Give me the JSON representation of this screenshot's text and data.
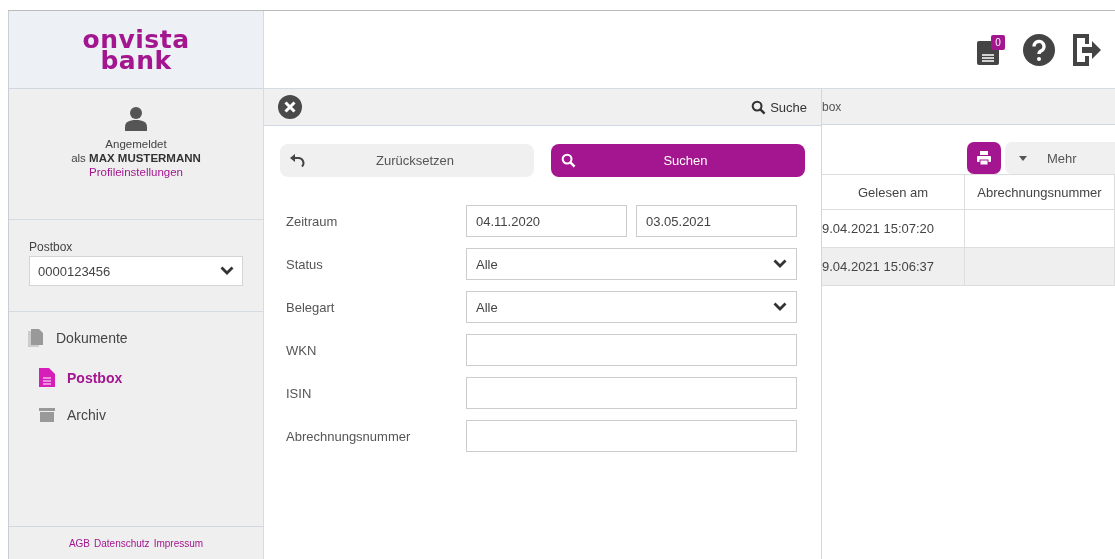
{
  "logo": {
    "line1": "onvista",
    "line2": "bank"
  },
  "user": {
    "status": "Angemeldet",
    "prefix": "als",
    "name": "MAX MUSTERMANN",
    "profile_link": "Profileinstellungen"
  },
  "postbox": {
    "label": "Postbox",
    "value": "0000123456"
  },
  "nav": [
    {
      "label": "Dokumente",
      "selected": false,
      "kind": "documents",
      "children": [
        {
          "label": "Postbox",
          "selected": true,
          "kind": "file"
        },
        {
          "label": "Archiv",
          "selected": false,
          "kind": "archive"
        }
      ]
    }
  ],
  "footer_links": [
    "AGB",
    "Datenschutz",
    "Impressum"
  ],
  "header": {
    "notification_count": "0"
  },
  "breadcrumb": "box",
  "search_panel": {
    "title": "Suche",
    "reset_button": "Zurücksetzen",
    "search_button": "Suchen",
    "fields": [
      {
        "label": "Zeitraum",
        "kind": "range",
        "values": [
          "04.11.2020",
          "03.05.2021"
        ]
      },
      {
        "label": "Status",
        "kind": "select",
        "value": "Alle"
      },
      {
        "label": "Belegart",
        "kind": "select",
        "value": "Alle"
      },
      {
        "label": "WKN",
        "kind": "text"
      },
      {
        "label": "ISIN",
        "kind": "text"
      },
      {
        "label": "Abrechnungsnummer",
        "kind": "text"
      }
    ]
  },
  "toolbar": {
    "more_button": "Mehr"
  },
  "table": {
    "columns": [
      "Gelesen am",
      "Abrechnungsnummer"
    ],
    "rows": [
      {
        "gelesen_am": "9.04.2021 15:07:20"
      },
      {
        "gelesen_am": "9.04.2021 15:06:37"
      }
    ]
  }
}
